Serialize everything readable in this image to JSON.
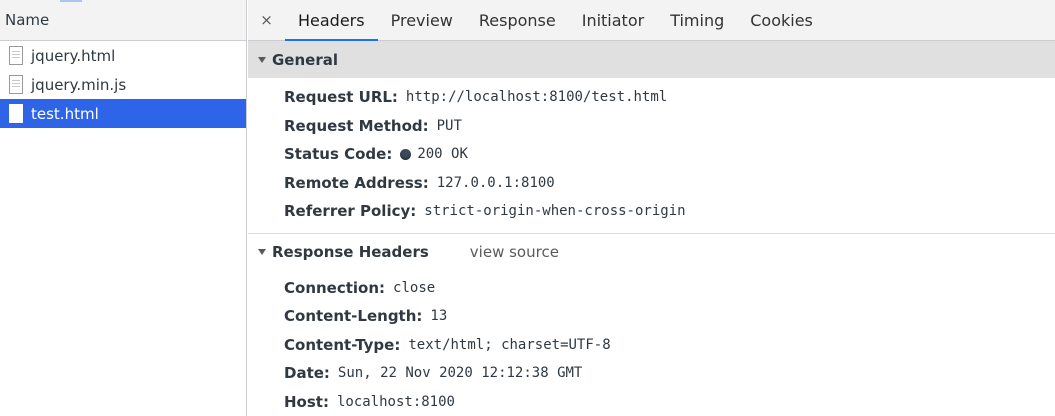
{
  "requests_panel": {
    "header": "Name",
    "items": [
      {
        "name": "jquery.html",
        "selected": false
      },
      {
        "name": "jquery.min.js",
        "selected": false
      },
      {
        "name": "test.html",
        "selected": true
      }
    ]
  },
  "tabs": {
    "close": "×",
    "items": [
      "Headers",
      "Preview",
      "Response",
      "Initiator",
      "Timing",
      "Cookies"
    ],
    "active": "Headers"
  },
  "general": {
    "title": "General",
    "rows": [
      {
        "key": "Request URL:",
        "value": "http://localhost:8100/test.html"
      },
      {
        "key": "Request Method:",
        "value": "PUT"
      },
      {
        "key": "Status Code:",
        "value": "200 OK"
      },
      {
        "key": "Remote Address:",
        "value": "127.0.0.1:8100"
      },
      {
        "key": "Referrer Policy:",
        "value": "strict-origin-when-cross-origin"
      }
    ]
  },
  "response_headers": {
    "title": "Response Headers",
    "view_source": "view source",
    "rows": [
      {
        "key": "Connection:",
        "value": "close"
      },
      {
        "key": "Content-Length:",
        "value": "13"
      },
      {
        "key": "Content-Type:",
        "value": "text/html; charset=UTF-8"
      },
      {
        "key": "Date:",
        "value": "Sun, 22 Nov 2020 12:12:38 GMT"
      },
      {
        "key": "Host:",
        "value": "localhost:8100"
      }
    ]
  },
  "colors": {
    "selected_row": "#2e64e8",
    "active_tab_underline": "#1a73e8",
    "section_header_bg": "#e0e0e0"
  }
}
